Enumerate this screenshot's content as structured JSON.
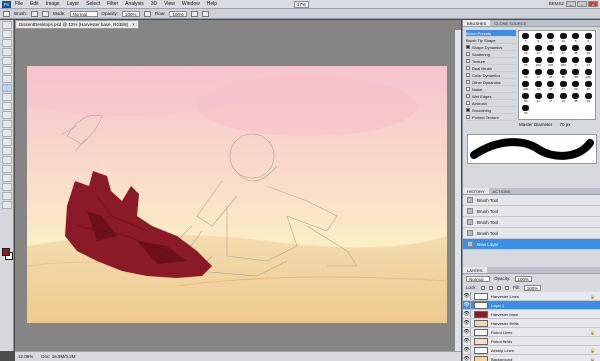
{
  "menubar": {
    "logo": "Ps",
    "items": [
      "File",
      "Edit",
      "Image",
      "Layer",
      "Select",
      "Filter",
      "Analysis",
      "3D",
      "View",
      "Window",
      "Help"
    ],
    "zoom": "17%",
    "workspace": "BEMS2"
  },
  "options": {
    "tool_label": "Brush:",
    "mode_label": "Mode:",
    "mode_value": "Normal",
    "opacity_label": "Opacity:",
    "opacity_value": "100%",
    "flow_label": "Flow:",
    "flow_value": "100%"
  },
  "document": {
    "tab_title": "DissentDesktops.psd @ 12% (Harvester base, RGB/8)",
    "zoom": "12.09%",
    "doc_size": "Doc: 16.9M/3.2M",
    "colors": {
      "foreground": "#8a1a25",
      "background": "#ffffff"
    }
  },
  "brushes": {
    "tabs": [
      "BRUSHES",
      "CLONE SOURCE"
    ],
    "list": [
      {
        "label": "Brush Presets",
        "checked": false,
        "selected": true
      },
      {
        "label": "Brush Tip Shape",
        "checked": false,
        "selected": false
      },
      {
        "label": "Shape Dynamics",
        "checked": true,
        "selected": false
      },
      {
        "label": "Scattering",
        "checked": false,
        "selected": false
      },
      {
        "label": "Texture",
        "checked": false,
        "selected": false
      },
      {
        "label": "Dual Brush",
        "checked": false,
        "selected": false
      },
      {
        "label": "Color Dynamics",
        "checked": false,
        "selected": false
      },
      {
        "label": "Other Dynamics",
        "checked": false,
        "selected": false
      },
      {
        "label": "Noise",
        "checked": false,
        "selected": false
      },
      {
        "label": "Wet Edges",
        "checked": false,
        "selected": false
      },
      {
        "label": "Airbrush",
        "checked": false,
        "selected": false
      },
      {
        "label": "Smoothing",
        "checked": true,
        "selected": false
      },
      {
        "label": "Protect Texture",
        "checked": false,
        "selected": false
      }
    ],
    "tip_sizes": [
      "5",
      "9",
      "13",
      "19",
      "5",
      "9",
      "13",
      "17",
      "21",
      "27",
      "35",
      "45",
      "65",
      "100",
      "200",
      "300",
      "9",
      "13",
      "19",
      "17",
      "45",
      "65",
      "100",
      "200",
      "300",
      "14",
      "24",
      "27",
      "39",
      "46",
      "59",
      "11",
      "17",
      "23",
      "36",
      "44",
      "60"
    ],
    "master_diameter_label": "Master Diameter",
    "master_diameter_value": "70 px"
  },
  "history": {
    "tabs": [
      "HISTORY",
      "ACTIONS"
    ],
    "items": [
      {
        "label": "Brush Tool",
        "selected": false
      },
      {
        "label": "Brush Tool",
        "selected": false
      },
      {
        "label": "Brush Tool",
        "selected": false
      },
      {
        "label": "Brush Tool",
        "selected": false
      },
      {
        "label": "New Layer",
        "selected": true
      }
    ]
  },
  "layers": {
    "tab": "LAYERS",
    "blend_mode": "Normal",
    "opacity_label": "Opacity:",
    "opacity_value": "100%",
    "lock_label": "Lock:",
    "fill_label": "Fill:",
    "fill_value": "100%",
    "items": [
      {
        "label": "Harvester Lines",
        "selected": false,
        "locked": true,
        "thumb": "#ffffff"
      },
      {
        "label": "Layer 1",
        "selected": true,
        "locked": false,
        "thumb": "#ffffff"
      },
      {
        "label": "Harvester base",
        "selected": false,
        "locked": false,
        "thumb": "#8a1a25"
      },
      {
        "label": "Harvester fields",
        "selected": false,
        "locked": false,
        "thumb": "#f0d7b0"
      },
      {
        "label": "Robot Lines",
        "selected": false,
        "locked": true,
        "thumb": "#ffffff"
      },
      {
        "label": "Robot fields",
        "selected": false,
        "locked": false,
        "thumb": "#f3e0c0"
      },
      {
        "label": "Airship Lines",
        "selected": false,
        "locked": true,
        "thumb": "#ffffff"
      },
      {
        "label": "Background",
        "selected": false,
        "locked": true,
        "thumb": "#f7d58f"
      }
    ]
  }
}
